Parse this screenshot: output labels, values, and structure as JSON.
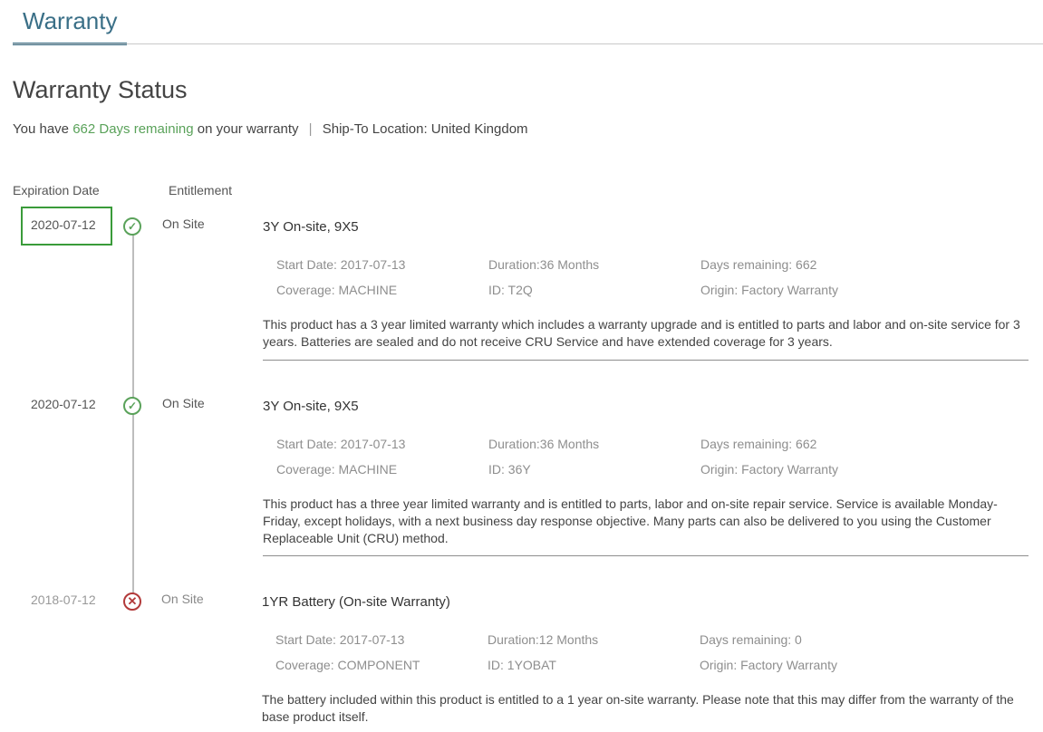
{
  "tabs": {
    "active_label": "Warranty"
  },
  "page": {
    "title": "Warranty Status",
    "summary": {
      "prefix": "You have",
      "days_remaining_text": "662 Days remaining",
      "suffix": "on your warranty",
      "separator": "|",
      "ship_to": "Ship-To Location: United Kingdom"
    }
  },
  "columns": {
    "expiration": "Expiration Date",
    "entitlement": "Entitlement"
  },
  "colors": {
    "accent": "#3a6f87",
    "active_green": "#5aa25a",
    "expired_red": "#b23a3a",
    "highlight_border": "#3a9b3a"
  },
  "entitlements": [
    {
      "expiration": "2020-07-12",
      "status": "active",
      "status_icon": "check-circle-icon",
      "entitlement": "On Site",
      "product": "3Y On-site, 9X5",
      "start_date": "Start Date: 2017-07-13",
      "duration": "Duration:36 Months",
      "days_remaining": "Days remaining: 662",
      "coverage": "Coverage: MACHINE",
      "id": "ID: T2Q",
      "origin": "Origin: Factory Warranty",
      "description": "This product has a 3 year limited warranty which includes a warranty upgrade and is entitled to parts and labor and on-site service for 3 years. Batteries are sealed and do not receive CRU Service and have extended coverage for 3 years."
    },
    {
      "expiration": "2020-07-12",
      "status": "active",
      "status_icon": "check-circle-icon",
      "entitlement": "On Site",
      "product": "3Y On-site, 9X5",
      "start_date": "Start Date: 2017-07-13",
      "duration": "Duration:36 Months",
      "days_remaining": "Days remaining: 662",
      "coverage": "Coverage: MACHINE",
      "id": "ID: 36Y",
      "origin": "Origin: Factory Warranty",
      "description": "This product has a three year limited warranty and is entitled to parts, labor and on-site repair service. Service is available Monday-Friday, except holidays, with a next business day response objective. Many parts can also be delivered to you using the Customer Replaceable Unit (CRU) method."
    },
    {
      "expiration": "2018-07-12",
      "status": "expired",
      "status_icon": "x-circle-icon",
      "entitlement": "On Site",
      "product": "1YR Battery (On-site Warranty)",
      "start_date": "Start Date: 2017-07-13",
      "duration": "Duration:12 Months",
      "days_remaining": "Days remaining: 0",
      "coverage": "Coverage: COMPONENT",
      "id": "ID: 1YOBAT",
      "origin": "Origin: Factory Warranty",
      "description": "The battery included within this product is entitled to a 1 year on-site warranty. Please note that this may differ from the warranty of the base product itself."
    }
  ]
}
